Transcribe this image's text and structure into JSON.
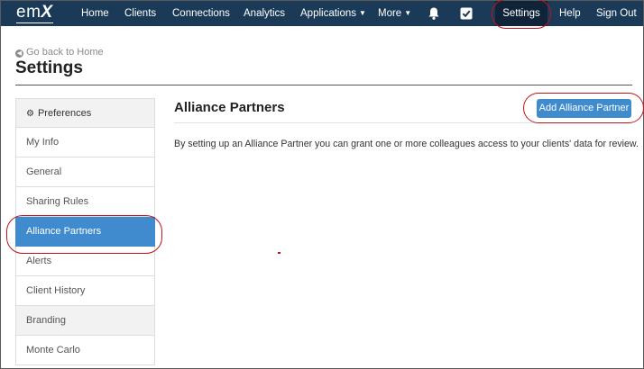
{
  "nav": {
    "logo": {
      "prefix": "em",
      "suffix": "X"
    },
    "items": [
      "Home",
      "Clients",
      "Connections",
      "Analytics",
      "Applications",
      "More"
    ],
    "icons": [
      "bell-icon",
      "checkbox-icon"
    ],
    "right_items": [
      "Settings",
      "Help",
      "Sign Out"
    ],
    "active": "Settings"
  },
  "header": {
    "back_link": "Go back to Home",
    "page_title": "Settings"
  },
  "sidebar": {
    "header": "Preferences",
    "items": [
      "My Info",
      "General",
      "Sharing Rules",
      "Alliance Partners",
      "Alerts",
      "Client History",
      "Branding",
      "Monte Carlo"
    ],
    "active": "Alliance Partners"
  },
  "main": {
    "title": "Alliance Partners",
    "add_button": "Add Alliance Partner",
    "description": "By setting up an Alliance Partner you can grant one or more colleagues access to your clients' data for review."
  },
  "colors": {
    "navbar": "#1b3a57",
    "accent": "#3f8bce",
    "annotation": "#c2131d"
  }
}
